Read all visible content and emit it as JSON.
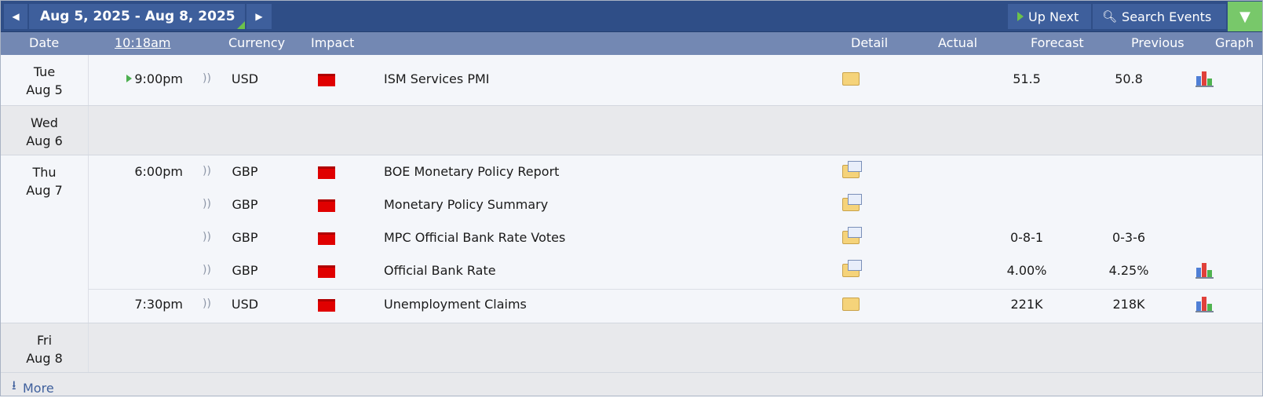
{
  "toolbar": {
    "prev_icon": "◀",
    "date_range": "Aug 5, 2025 - Aug 8, 2025",
    "next_icon": "▶",
    "up_next": "Up Next",
    "search_events": "Search Events",
    "filter_icon": "▼"
  },
  "header": {
    "date": "Date",
    "time": "10:18am",
    "currency": "Currency",
    "impact": "Impact",
    "detail": "Detail",
    "actual": "Actual",
    "forecast": "Forecast",
    "previous": "Previous",
    "graph": "Graph"
  },
  "days": [
    {
      "dow": "Tue",
      "date": "Aug 5"
    },
    {
      "dow": "Wed",
      "date": "Aug 6"
    },
    {
      "dow": "Thu",
      "date": "Aug 7"
    },
    {
      "dow": "Fri",
      "date": "Aug 8"
    }
  ],
  "events": [
    {
      "time": "9:00pm",
      "currency": "USD",
      "name": "ISM Services PMI",
      "forecast": "51.5",
      "previous": "50.8"
    },
    {
      "time": "6:00pm",
      "currency": "GBP",
      "name": "BOE Monetary Policy Report",
      "forecast": "",
      "previous": ""
    },
    {
      "time": "",
      "currency": "GBP",
      "name": "Monetary Policy Summary",
      "forecast": "",
      "previous": ""
    },
    {
      "time": "",
      "currency": "GBP",
      "name": "MPC Official Bank Rate Votes",
      "forecast": "0-8-1",
      "previous": "0-3-6"
    },
    {
      "time": "",
      "currency": "GBP",
      "name": "Official Bank Rate",
      "forecast": "4.00%",
      "previous": "4.25%"
    },
    {
      "time": "7:30pm",
      "currency": "USD",
      "name": "Unemployment Claims",
      "forecast": "221K",
      "previous": "218K"
    }
  ],
  "sound_icon": "))",
  "more": "More",
  "colors": {
    "topbar": "#2f4e87",
    "header": "#7388b3",
    "impact_high": "#e00000",
    "accent_green": "#6cc24a"
  }
}
